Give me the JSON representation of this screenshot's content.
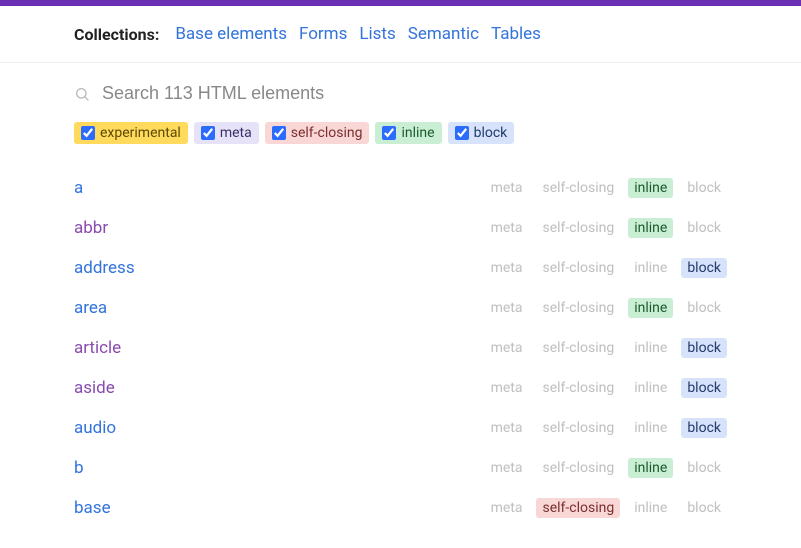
{
  "header": {
    "label": "Collections:",
    "links": [
      "Base elements",
      "Forms",
      "Lists",
      "Semantic",
      "Tables"
    ]
  },
  "search": {
    "placeholder": "Search 113 HTML elements"
  },
  "filters": [
    {
      "key": "experimental",
      "label": "experimental",
      "checked": true,
      "chipClass": "chip-experimental"
    },
    {
      "key": "meta",
      "label": "meta",
      "checked": true,
      "chipClass": "chip-meta"
    },
    {
      "key": "selfclosing",
      "label": "self-closing",
      "checked": true,
      "chipClass": "chip-selfclosing"
    },
    {
      "key": "inline",
      "label": "inline",
      "checked": true,
      "chipClass": "chip-inline"
    },
    {
      "key": "block",
      "label": "block",
      "checked": true,
      "chipClass": "chip-block"
    }
  ],
  "badge_keys": [
    "meta",
    "selfclosing",
    "inline",
    "block"
  ],
  "badge_labels": {
    "meta": "meta",
    "selfclosing": "self-closing",
    "inline": "inline",
    "block": "block"
  },
  "elements": [
    {
      "name": "a",
      "visited": false,
      "active": [
        "inline"
      ]
    },
    {
      "name": "abbr",
      "visited": true,
      "active": [
        "inline"
      ]
    },
    {
      "name": "address",
      "visited": false,
      "active": [
        "block"
      ]
    },
    {
      "name": "area",
      "visited": false,
      "active": [
        "inline"
      ]
    },
    {
      "name": "article",
      "visited": true,
      "active": [
        "block"
      ]
    },
    {
      "name": "aside",
      "visited": true,
      "active": [
        "block"
      ]
    },
    {
      "name": "audio",
      "visited": false,
      "active": [
        "block"
      ]
    },
    {
      "name": "b",
      "visited": false,
      "active": [
        "inline"
      ]
    },
    {
      "name": "base",
      "visited": false,
      "active": [
        "selfclosing"
      ]
    }
  ]
}
